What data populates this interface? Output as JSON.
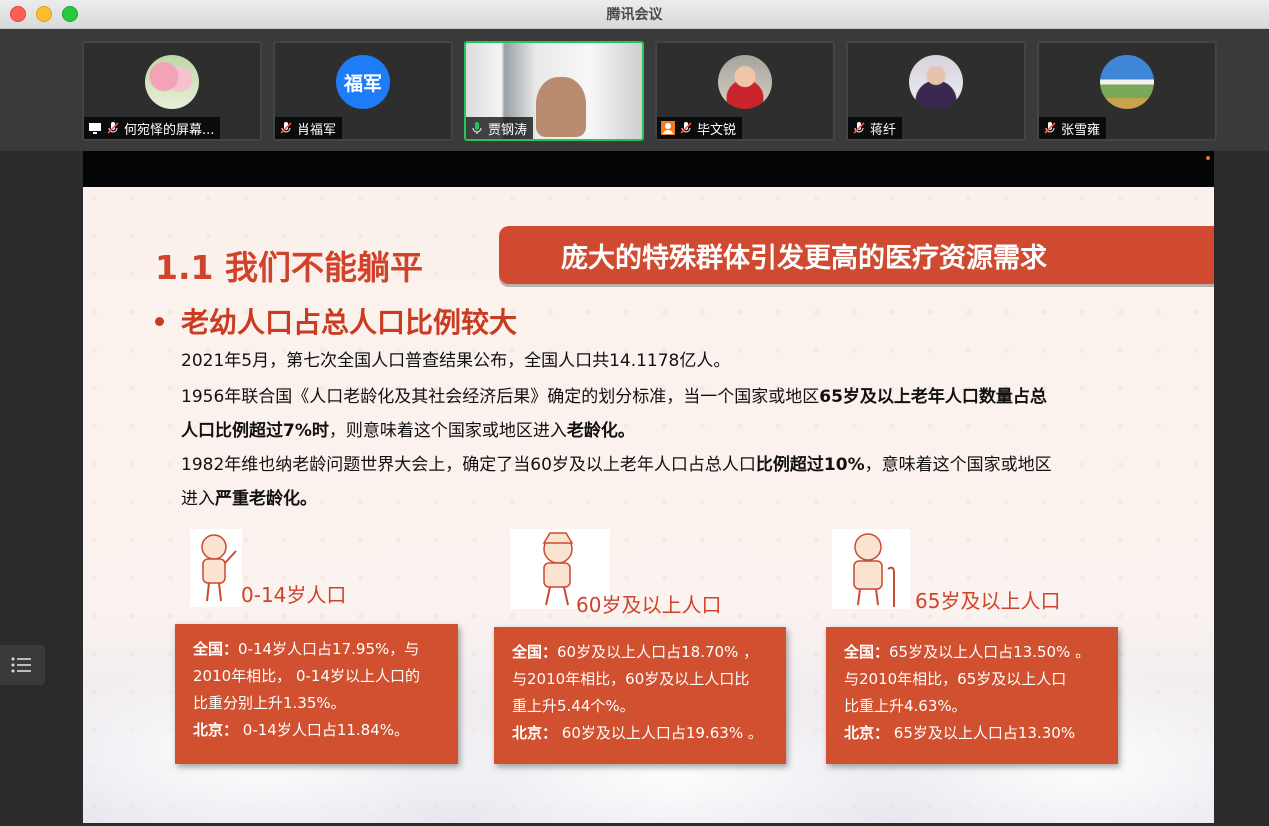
{
  "window": {
    "title": "腾讯会议"
  },
  "participants": [
    {
      "name": "何宛怿的屏幕...",
      "avatar": "tulip-photo",
      "mic": "mic-off",
      "screen_share": true
    },
    {
      "name": "肖福军",
      "avatar_text": "福军",
      "mic": "mic-off"
    },
    {
      "name": "贾钢涛",
      "avatar": "video",
      "mic": "mic-on",
      "active": true
    },
    {
      "name": "毕文锐",
      "avatar": "child-photo",
      "mic": "mic-off",
      "host_icon": true
    },
    {
      "name": "蒋纤",
      "avatar": "person-photo",
      "mic": "mic-off"
    },
    {
      "name": "张雪雍",
      "avatar": "landscape-photo",
      "mic": "mic-off"
    }
  ],
  "slide": {
    "section_title": "1.1 我们不能躺平",
    "banner": "庞大的特殊群体引发更高的医疗资源需求",
    "bullet": "老幼人口占总人口比例较大",
    "p1": "2021年5月，第七次全国人口普查结果公布，全国人口共14.1178亿人。",
    "p2a": "1956年联合国《人口老龄化及其社会经济后果》确定的划分标准，当一个国家或地区",
    "p2b": "65岁及以上老年人口数量占总",
    "p3a": "人口比例超过7%时",
    "p3b": "，则意味着这个国家或地区进入",
    "p3c": "老龄化。",
    "p4a": "1982年维也纳老龄问题世界大会上，确定了当60岁及以上老年人口占总人口",
    "p4b": "比例超过10%",
    "p4c": "，意味着这个国家或地区",
    "p5a": "进入",
    "p5b": "严重老龄化。",
    "groups": [
      {
        "label": "0-14岁人口",
        "icon": "child-icon",
        "lines": [
          {
            "bold": "全国：",
            "text": "0-14岁人口占17.95%，与"
          },
          {
            "bold": "",
            "text": "2010年相比， 0-14岁以上人口的"
          },
          {
            "bold": "",
            "text": "比重分别上升1.35%。"
          },
          {
            "bold": "北京：",
            "text": " 0-14岁人口占11.84%。"
          }
        ]
      },
      {
        "label": "60岁及以上人口",
        "icon": "elder-icon",
        "lines": [
          {
            "bold": "全国：",
            "text": "60岁及以上人口占18.70% ，"
          },
          {
            "bold": "",
            "text": "与2010年相比，60岁及以上人口比"
          },
          {
            "bold": "",
            "text": "重上升5.44个%。"
          },
          {
            "bold": "北京：",
            "text": " 60岁及以上人口占19.63% 。"
          }
        ]
      },
      {
        "label": "65岁及以上人口",
        "icon": "elder-cane-icon",
        "lines": [
          {
            "bold": "全国：",
            "text": "65岁及以上人口占13.50% 。"
          },
          {
            "bold": "",
            "text": "与2010年相比，65岁及以上人口"
          },
          {
            "bold": "",
            "text": "比重上升4.63%。"
          },
          {
            "bold": "北京：",
            "text": " 65岁及以上人口占13.30%"
          }
        ]
      }
    ]
  },
  "colors": {
    "accent": "#d0432a",
    "card": "#d0502f",
    "active_border": "#25c45a"
  }
}
